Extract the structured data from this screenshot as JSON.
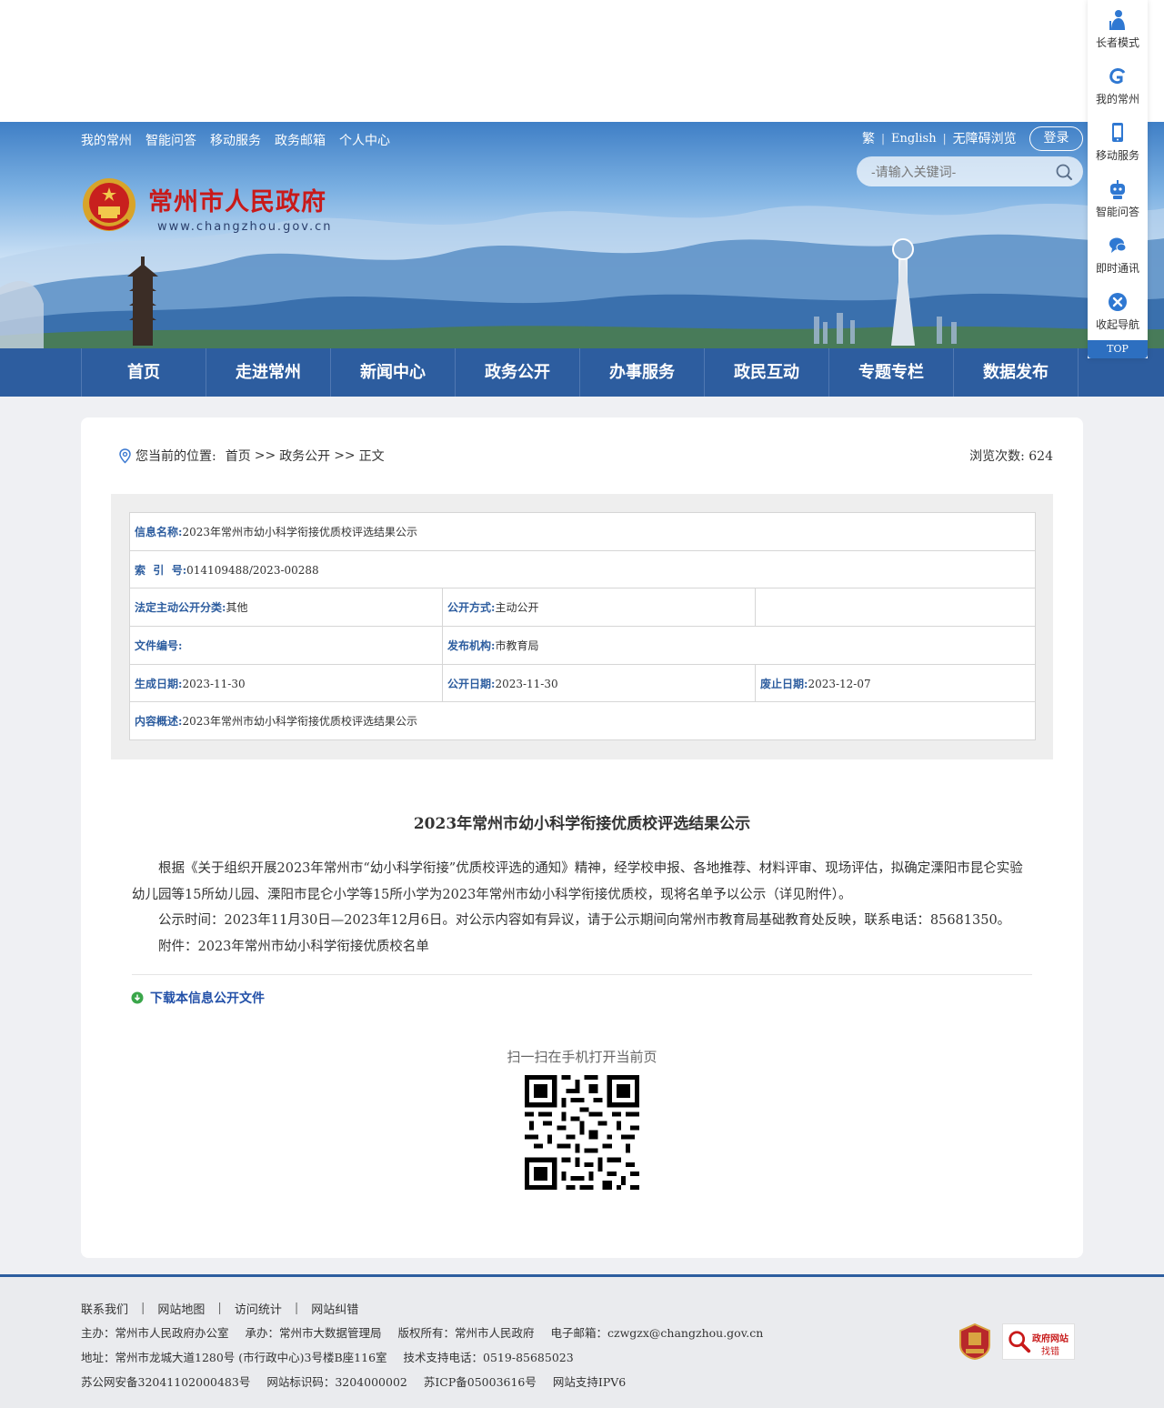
{
  "header": {
    "top_links": [
      "我的常州",
      "智能问答",
      "移动服务",
      "政务邮箱",
      "个人中心"
    ],
    "lang_traditional": "繁",
    "lang_english": "English",
    "accessibility": "无障碍浏览",
    "login": "登录",
    "search_placeholder": "-请输入关键词-",
    "site_title": "常州市人民政府",
    "site_url": "www.changzhou.gov.cn"
  },
  "nav": [
    "首页",
    "走进常州",
    "新闻中心",
    "政务公开",
    "办事服务",
    "政民互动",
    "专题专栏",
    "数据发布"
  ],
  "breadcrumb": {
    "label": "您当前的位置:",
    "items": [
      "首页",
      "政务公开",
      "正文"
    ],
    "separator": ">>"
  },
  "views": {
    "label": "浏览次数:",
    "count": "624"
  },
  "info": {
    "name_label": "信息名称:",
    "name_value": "2023年常州市幼小科学衔接优质校评选结果公示",
    "index_label": "索  引  号:",
    "index_value": "014109488/2023-00288",
    "category_label": "法定主动公开分类:",
    "category_value": "其他",
    "mode_label": "公开方式:",
    "mode_value": "主动公开",
    "docno_label": "文件编号:",
    "docno_value": "",
    "publisher_label": "发布机构:",
    "publisher_value": "市教育局",
    "created_label": "生成日期:",
    "created_value": "2023-11-30",
    "published_label": "公开日期:",
    "published_value": "2023-11-30",
    "expired_label": "废止日期:",
    "expired_value": "2023-12-07",
    "summary_label": "内容概述:",
    "summary_value": "2023年常州市幼小科学衔接优质校评选结果公示"
  },
  "article": {
    "title": "2023年常州市幼小科学衔接优质校评选结果公示",
    "paragraphs": [
      "根据《关于组织开展2023年常州市“幼小科学衔接”优质校评选的通知》精神，经学校申报、各地推荐、材料评审、现场评估，拟确定溧阳市昆仑实验幼儿园等15所幼儿园、溧阳市昆仑小学等15所小学为2023年常州市幼小科学衔接优质校，现将名单予以公示（详见附件）。",
      "公示时间：2023年11月30日—2023年12月6日。对公示内容如有异议，请于公示期间向常州市教育局基础教育处反映，联系电话：85681350。",
      "附件：2023年常州市幼小科学衔接优质校名单"
    ]
  },
  "download_label": "下载本信息公开文件",
  "qr_caption": "扫一扫在手机打开当前页",
  "footer": {
    "links": [
      "联系我们",
      "网站地图",
      "访问统计",
      "网站纠错"
    ],
    "line1": [
      "主办：常州市人民政府办公室",
      "承办：常州市大数据管理局",
      "版权所有：常州市人民政府",
      "电子邮箱：czwgzx@changzhou.gov.cn"
    ],
    "line2": [
      "地址：常州市龙城大道1280号 (市行政中心)3号楼B座116室",
      "技术支持电话：0519-85685023"
    ],
    "line3": [
      "苏公网安备32041102000483号",
      "网站标识码：3204000002",
      "苏ICP备05003616号",
      "网站支持IPV6"
    ],
    "badge_text_1": "政府网站",
    "badge_text_2": "找错"
  },
  "sidebar": {
    "items": [
      "长者模式",
      "我的常州",
      "移动服务",
      "智能问答",
      "即时通讯",
      "收起导航"
    ],
    "top": "TOP"
  },
  "colors": {
    "brand_blue": "#2d5d9f",
    "title_red": "#c81a1a",
    "link_blue": "#2250a8"
  }
}
